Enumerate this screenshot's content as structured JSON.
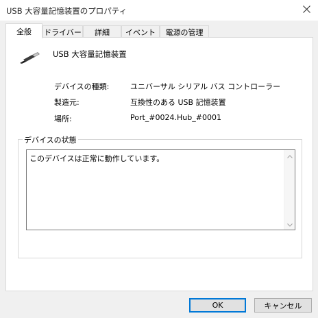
{
  "window": {
    "title": "USB 大容量記憶装置のプロパティ",
    "close_icon": "close-icon"
  },
  "tabs": [
    {
      "label": "全般",
      "active": true
    },
    {
      "label": "ドライバー",
      "active": false
    },
    {
      "label": "詳細",
      "active": false
    },
    {
      "label": "イベント",
      "active": false
    },
    {
      "label": "電源の管理",
      "active": false
    }
  ],
  "device": {
    "icon": "usb-device-icon",
    "name": "USB 大容量記憶装置"
  },
  "properties": [
    {
      "label": "デバイスの種類:",
      "value": "ユニバーサル シリアル バス コントローラー"
    },
    {
      "label": "製造元:",
      "value": "互換性のある USB 記憶装置"
    },
    {
      "label": "場所:",
      "value": "Port_#0024.Hub_#0001"
    }
  ],
  "status": {
    "legend": "デバイスの状態",
    "text": "このデバイスは正常に動作しています。"
  },
  "buttons": {
    "ok": "OK",
    "cancel": "キャンセル"
  },
  "colors": {
    "accent": "#0078d7",
    "window_bg": "#f0f0f0",
    "panel_bg": "#ffffff"
  }
}
